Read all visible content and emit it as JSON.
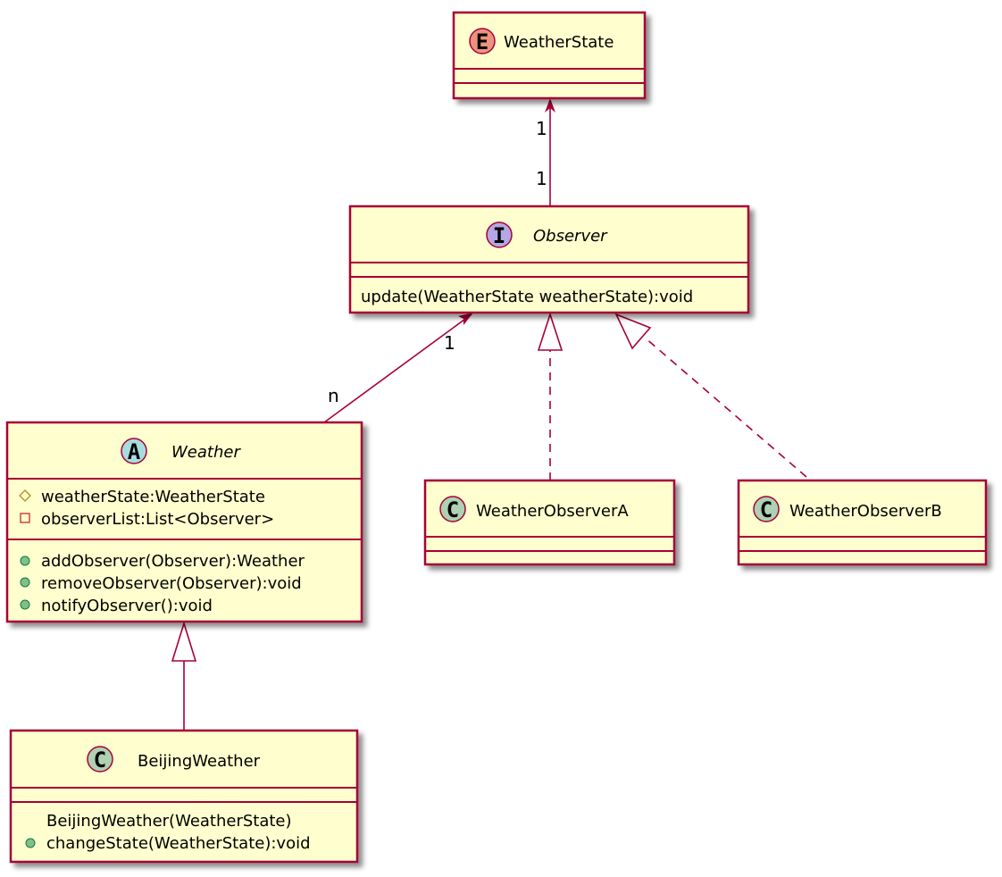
{
  "colors": {
    "border": "#A80036",
    "fill": "#FEFECE",
    "enum": "#EB937F",
    "interface": "#B4A7E5",
    "abstract": "#A9DCDF",
    "class": "#ADD1B2",
    "public": "#84BE84",
    "private": "#C82930",
    "protected": "#B38D22"
  },
  "classes": {
    "weatherState": {
      "glyph": "E",
      "name": "WeatherState"
    },
    "observer": {
      "glyph": "I",
      "name": "Observer",
      "methods": [
        "update(WeatherState weatherState):void"
      ]
    },
    "weather": {
      "glyph": "A",
      "name": "Weather",
      "fields": [
        "weatherState:WeatherState",
        "observerList:List<Observer>"
      ],
      "methods": [
        "addObserver(Observer):Weather",
        "removeObserver(Observer):void",
        "notifyObserver():void"
      ]
    },
    "observerA": {
      "glyph": "C",
      "name": "WeatherObserverA"
    },
    "observerB": {
      "glyph": "C",
      "name": "WeatherObserverB"
    },
    "beijing": {
      "glyph": "C",
      "name": "BeijingWeather",
      "methods": [
        "BeijingWeather(WeatherState)",
        "changeState(WeatherState):void"
      ]
    }
  },
  "edges": {
    "observerToState": {
      "source_mult": "1",
      "target_mult": "1"
    },
    "weatherToObserver": {
      "source_mult": "n",
      "target_mult": "1"
    }
  }
}
